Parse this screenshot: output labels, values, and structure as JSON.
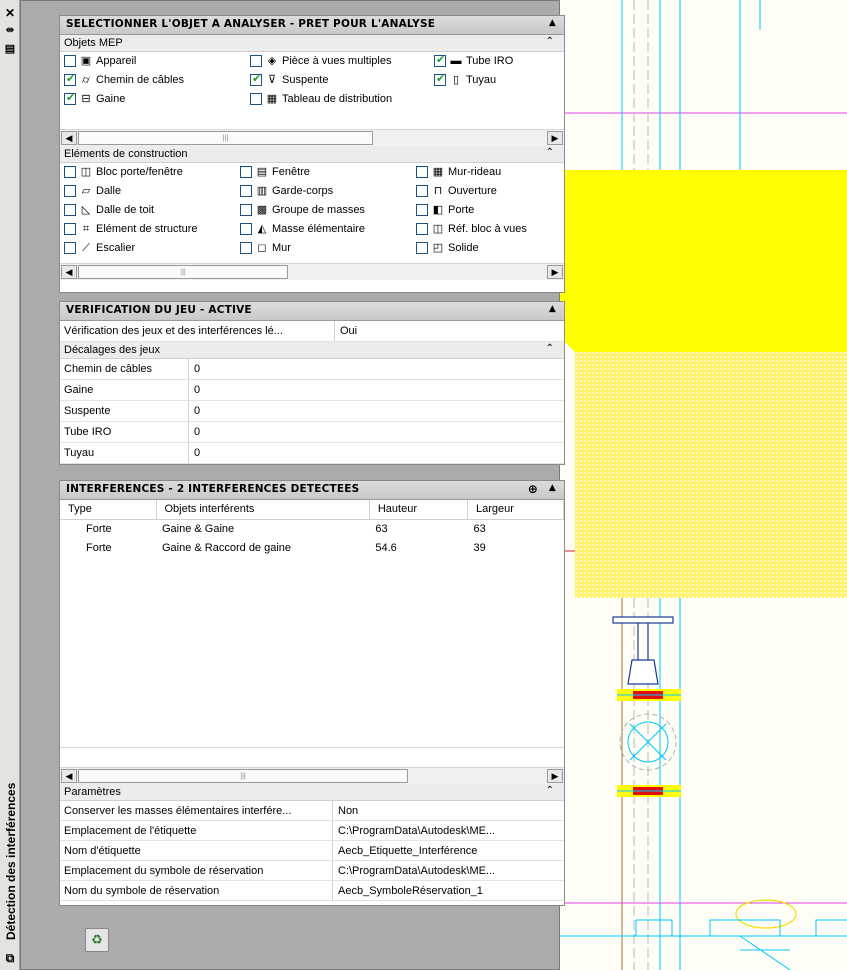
{
  "sidebar": {
    "close_glyph": "✕",
    "autohide_glyph": "⇹",
    "props_glyph": "▤",
    "title": "Détection des interférences"
  },
  "select_panel": {
    "header": "SELECTIONNER L'OBJET A ANALYSER - PRET POUR L'ANALYSE",
    "mep": {
      "title": "Objets MEP",
      "items": [
        {
          "label": "Appareil",
          "checked": false,
          "icon": "appliance-icon"
        },
        {
          "label": "Pièce à vues multiples",
          "checked": false,
          "icon": "multiview-part-icon"
        },
        {
          "label": "Tube IRO",
          "checked": true,
          "icon": "conduit-icon"
        },
        {
          "label": "Chemin de câbles",
          "checked": true,
          "icon": "cable-tray-icon"
        },
        {
          "label": "Suspente",
          "checked": true,
          "icon": "hanger-icon"
        },
        {
          "label": "Tuyau",
          "checked": true,
          "icon": "pipe-icon"
        },
        {
          "label": "Gaine",
          "checked": true,
          "icon": "duct-icon"
        },
        {
          "label": "Tableau de distribution",
          "checked": false,
          "icon": "panel-icon"
        }
      ]
    },
    "construction": {
      "title": "Eléments de construction",
      "items": [
        {
          "label": "Bloc porte/fenêtre",
          "checked": false,
          "icon": "door-window-assembly-icon"
        },
        {
          "label": "Fenêtre",
          "checked": false,
          "icon": "window-icon"
        },
        {
          "label": "Mur-rideau",
          "checked": false,
          "icon": "curtain-wall-icon"
        },
        {
          "label": "Dalle",
          "checked": false,
          "icon": "slab-icon"
        },
        {
          "label": "Garde-corps",
          "checked": false,
          "icon": "railing-icon"
        },
        {
          "label": "Ouverture",
          "checked": false,
          "icon": "opening-icon"
        },
        {
          "label": "Dalle de toit",
          "checked": false,
          "icon": "roof-slab-icon"
        },
        {
          "label": "Groupe de masses",
          "checked": false,
          "icon": "mass-group-icon"
        },
        {
          "label": "Porte",
          "checked": false,
          "icon": "door-icon"
        },
        {
          "label": "Elément de structure",
          "checked": false,
          "icon": "structural-member-icon"
        },
        {
          "label": "Masse élémentaire",
          "checked": false,
          "icon": "mass-element-icon"
        },
        {
          "label": "Réf. bloc à vues",
          "checked": false,
          "icon": "mvblock-ref-icon"
        },
        {
          "label": "Escalier",
          "checked": false,
          "icon": "stair-icon"
        },
        {
          "label": "Mur",
          "checked": false,
          "icon": "wall-icon"
        },
        {
          "label": "Solide",
          "checked": false,
          "icon": "solid-icon"
        }
      ]
    }
  },
  "clearance_panel": {
    "header": "VERIFICATION DU JEU - ACTIVE",
    "check_label": "Vérification des jeux et des interférences lé...",
    "check_value": "Oui",
    "offsets_title": "Décalages des jeux",
    "offsets": [
      {
        "label": "Chemin de câbles",
        "value": "0"
      },
      {
        "label": "Gaine",
        "value": "0"
      },
      {
        "label": "Suspente",
        "value": "0"
      },
      {
        "label": "Tube IRO",
        "value": "0"
      },
      {
        "label": "Tuyau",
        "value": "0"
      }
    ]
  },
  "interference_panel": {
    "header": "INTERFERENCES - 2 INTERFERENCES DETECTEES",
    "columns": [
      "Type",
      "Objets interférents",
      "Hauteur",
      "Largeur"
    ],
    "rows": [
      [
        "Forte",
        "Gaine & Gaine",
        "63",
        "63"
      ],
      [
        "Forte",
        "Gaine & Raccord de gaine",
        "54.6",
        "39"
      ]
    ],
    "params_title": "Paramètres",
    "params": [
      {
        "label": "Conserver les masses élémentaires interfére...",
        "value": "Non"
      },
      {
        "label": "Emplacement de l'étiquette",
        "value": "C:\\ProgramData\\Autodesk\\ME..."
      },
      {
        "label": "Nom d'étiquette",
        "value": "Aecb_Etiquette_Interférence"
      },
      {
        "label": "Emplacement du symbole de réservation",
        "value": "C:\\ProgramData\\Autodesk\\ME..."
      },
      {
        "label": "Nom du symbole de réservation",
        "value": "Aecb_SymboleRéservation_1"
      }
    ]
  },
  "colors": {
    "highlight_yellow": "#ffff00",
    "cad_cyan": "#00c8ff",
    "cad_magenta": "#e040e0",
    "clash_red": "#e01010",
    "cad_background": "#fefef6"
  }
}
